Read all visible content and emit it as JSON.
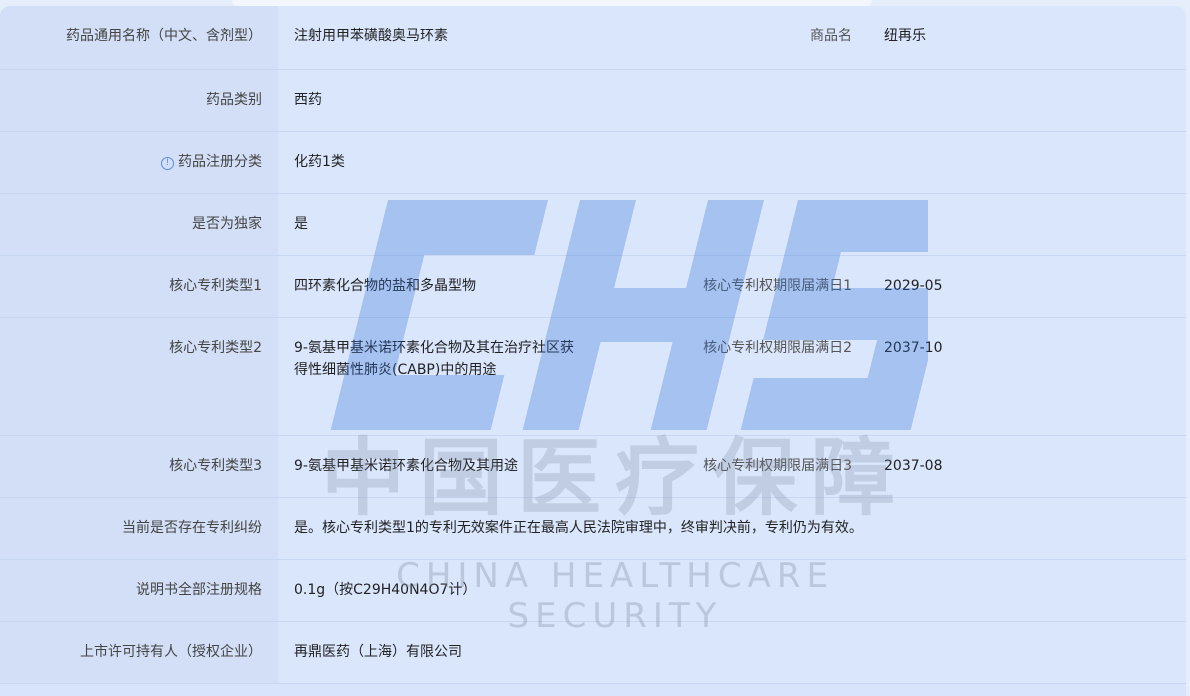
{
  "rows": [
    {
      "label": "药品通用名称（中文、含剂型）",
      "value": "注射用甲苯磺酸奥马环素",
      "label2": "商品名",
      "value2": "纽再乐"
    },
    {
      "label": "药品类别",
      "value": "西药"
    },
    {
      "label": "药品注册分类",
      "value": "化药1类",
      "icon": "info-icon"
    },
    {
      "label": "是否为独家",
      "value": "是"
    },
    {
      "label": "核心专利类型1",
      "value": "四环素化合物的盐和多晶型物",
      "label2": "核心专利权期限届满日1",
      "value2": "2029-05"
    },
    {
      "label": "核心专利类型2",
      "value": "9-氨基甲基米诺环素化合物及其在治疗社区获得性细菌性肺炎(CABP)中的用途",
      "label2": "核心专利权期限届满日2",
      "value2": "2037-10"
    },
    {
      "label": "核心专利类型3",
      "value": "9-氨基甲基米诺环素化合物及其用途",
      "label2": "核心专利权期限届满日3",
      "value2": "2037-08"
    },
    {
      "label": "当前是否存在专利纠纷",
      "value": "是。核心专利类型1的专利无效案件正在最高人民法院审理中，终审判决前，专利仍为有效。"
    },
    {
      "label": "说明书全部注册规格",
      "value": "0.1g（按C29H40N4O7计）"
    },
    {
      "label": "上市许可持有人（授权企业）",
      "value": "再鼎医药（上海）有限公司"
    }
  ],
  "watermark": {
    "logo_text": "CHS",
    "cn": "中国医疗保障",
    "en": "CHINA HEALTHCARE SECURITY",
    "color": "#2f6fd8"
  },
  "colors": {
    "label_bg": "#d2dff6",
    "value_bg": "#d9e6fc",
    "border": "#c8d7f2"
  }
}
